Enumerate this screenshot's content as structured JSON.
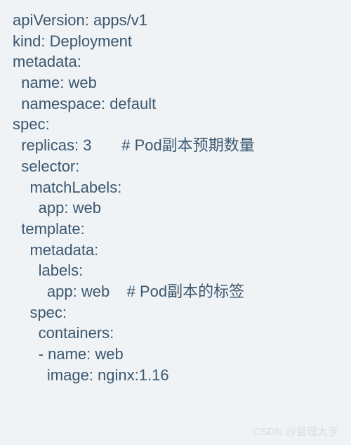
{
  "code": {
    "lines": [
      "apiVersion: apps/v1",
      "kind: Deployment",
      "metadata:",
      "  name: web",
      "  namespace: default",
      "spec:",
      "  replicas: 3       # Pod副本预期数量",
      "  selector:",
      "    matchLabels:",
      "      app: web",
      "  template:",
      "    metadata:",
      "      labels:",
      "        app: web    # Pod副本的标签",
      "    spec:",
      "      containers:",
      "      - name: web",
      "        image: nginx:1.16"
    ]
  },
  "watermark": "CSDN @管理大亨"
}
